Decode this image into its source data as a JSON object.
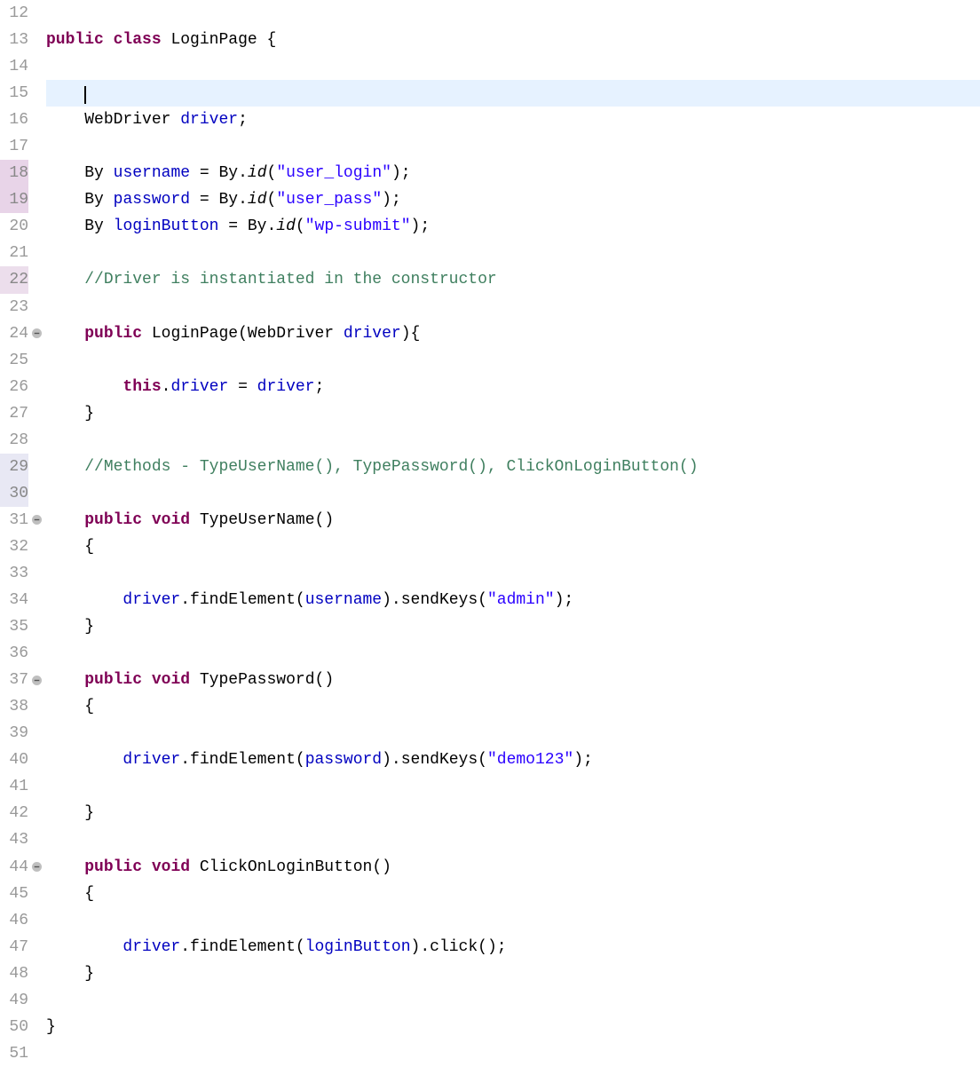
{
  "lineNumbers": [
    "12",
    "13",
    "14",
    "15",
    "16",
    "17",
    "18",
    "19",
    "20",
    "21",
    "22",
    "23",
    "24",
    "25",
    "26",
    "27",
    "28",
    "29",
    "30",
    "31",
    "32",
    "33",
    "34",
    "35",
    "36",
    "37",
    "38",
    "39",
    "40",
    "41",
    "42",
    "43",
    "44",
    "45",
    "46",
    "47",
    "48",
    "49",
    "50",
    "51"
  ],
  "highlightedGutter": {
    "18": "hl-mod",
    "19": "hl-mod",
    "22": "hl-mod3",
    "29": "hl-mod2",
    "30": "hl-mod2"
  },
  "foldLines": [
    "24",
    "31",
    "37",
    "44"
  ],
  "currentLine": "15",
  "tokens": {
    "kw_public": "public",
    "kw_class": "class",
    "kw_void": "void",
    "kw_this": "this",
    "cls_LoginPage": "LoginPage",
    "type_WebDriver": "WebDriver",
    "type_By": "By",
    "field_driver": "driver",
    "field_username": "username",
    "field_password": "password",
    "field_loginButton": "loginButton",
    "method_id": "id",
    "str_user_login": "\"user_login\"",
    "str_user_pass": "\"user_pass\"",
    "str_wp_submit": "\"wp-submit\"",
    "str_admin": "\"admin\"",
    "str_demo123": "\"demo123\"",
    "comment_driver": "//Driver is instantiated in the constructor",
    "comment_methods": "//Methods - TypeUserName(), TypePassword(), ClickOnLoginButton()",
    "m_TypeUserName": "TypeUserName",
    "m_TypePassword": "TypePassword",
    "m_ClickOnLoginButton": "ClickOnLoginButton",
    "m_findElement": "findElement",
    "m_sendKeys": "sendKeys",
    "m_click": "click",
    "param_driver": "driver",
    "brace_open": "{",
    "brace_close": "}",
    "paren_open": "(",
    "paren_close": ")",
    "semi": ";",
    "dot": ".",
    "eq": " = ",
    "sp": " "
  }
}
